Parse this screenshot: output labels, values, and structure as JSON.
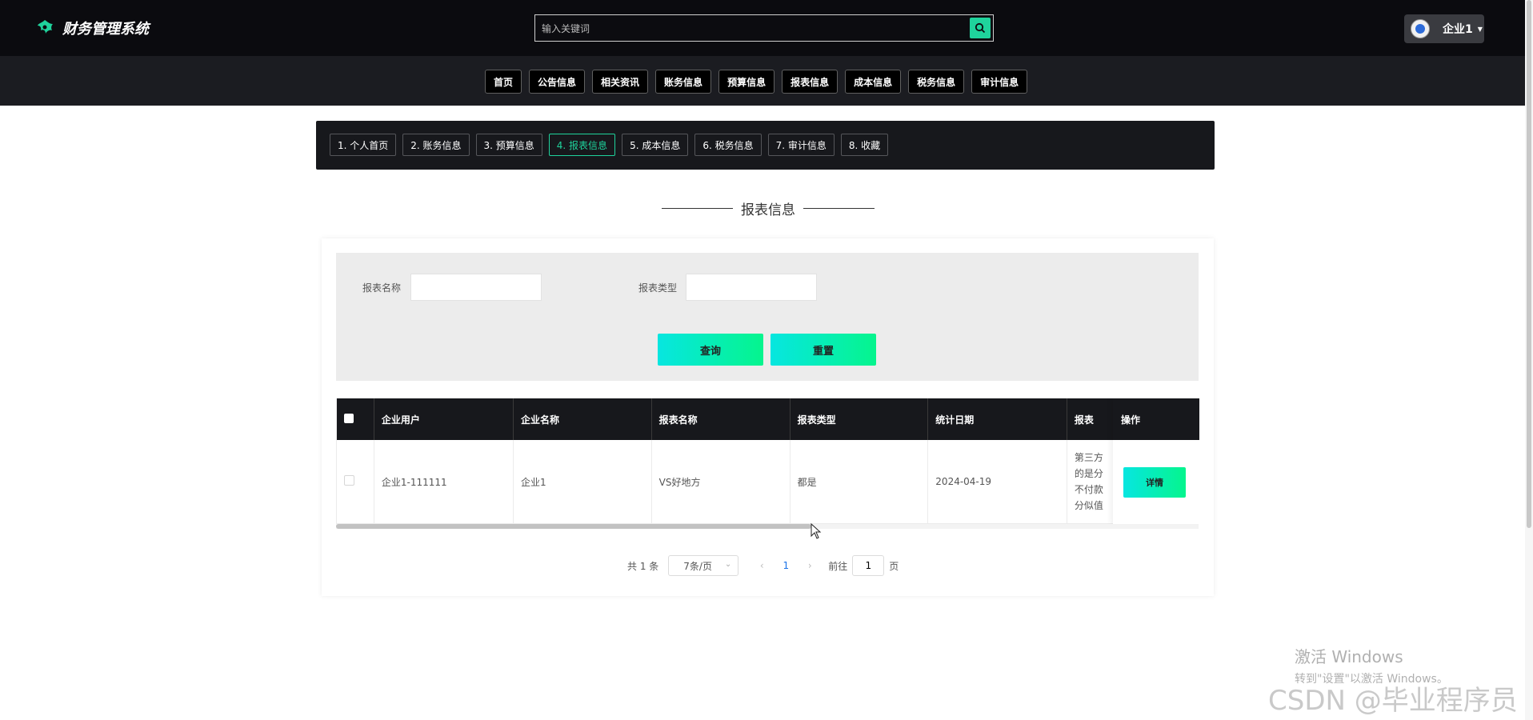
{
  "header": {
    "title": "财务管理系统",
    "search": {
      "placeholder": "输入关键词",
      "value": ""
    },
    "user": {
      "name": "企业1"
    }
  },
  "nav": {
    "items": [
      "首页",
      "公告信息",
      "相关资讯",
      "账务信息",
      "预算信息",
      "报表信息",
      "成本信息",
      "税务信息",
      "审计信息"
    ]
  },
  "subtabs": {
    "items": [
      "1. 个人首页",
      "2. 账务信息",
      "3. 预算信息",
      "4. 报表信息",
      "5. 成本信息",
      "6. 税务信息",
      "7. 审计信息",
      "8. 收藏"
    ],
    "active_index": 3
  },
  "page": {
    "title": "报表信息"
  },
  "filter": {
    "report_name_label": "报表名称",
    "report_name_value": "",
    "report_type_label": "报表类型",
    "report_type_value": "",
    "query_button": "查询",
    "reset_button": "重置"
  },
  "table": {
    "columns": [
      "企业用户",
      "企业名称",
      "报表名称",
      "报表类型",
      "统计日期",
      "报表数据"
    ],
    "column_visible_text": "报表",
    "action_column": "操作",
    "rows": [
      {
        "enterprise_user": "企业1-111111",
        "enterprise_name": "企业1",
        "report_name": "VS好地方",
        "report_type": "都是",
        "stat_date": "2024-04-19",
        "description_visible": [
          "第三方",
          "的是分",
          "不付款",
          "分似值"
        ],
        "action": "详情"
      }
    ],
    "horizontal_scroll_fraction": 0.55
  },
  "pagination": {
    "total_text": "共 1 条",
    "page_size": "7条/页",
    "prev": "‹",
    "next": "›",
    "current_page": "1",
    "goto_label": "前往",
    "goto_value": "1",
    "page_unit": "页"
  },
  "watermarks": {
    "windows_line1": "激活 Windows",
    "windows_line2": "转到\"设置\"以激活 Windows。",
    "csdn": "CSDN @毕业程序员"
  },
  "colors": {
    "accent": "#1fd39c",
    "header_bg": "#0b0b0f",
    "nav_bg": "#1b1c21",
    "button_gradient_start": "#07e6e0",
    "button_gradient_end": "#05f58d"
  },
  "icons": {
    "brand": "brand-leaf-icon",
    "search": "search-icon",
    "user_caret": "caret-down-icon"
  }
}
